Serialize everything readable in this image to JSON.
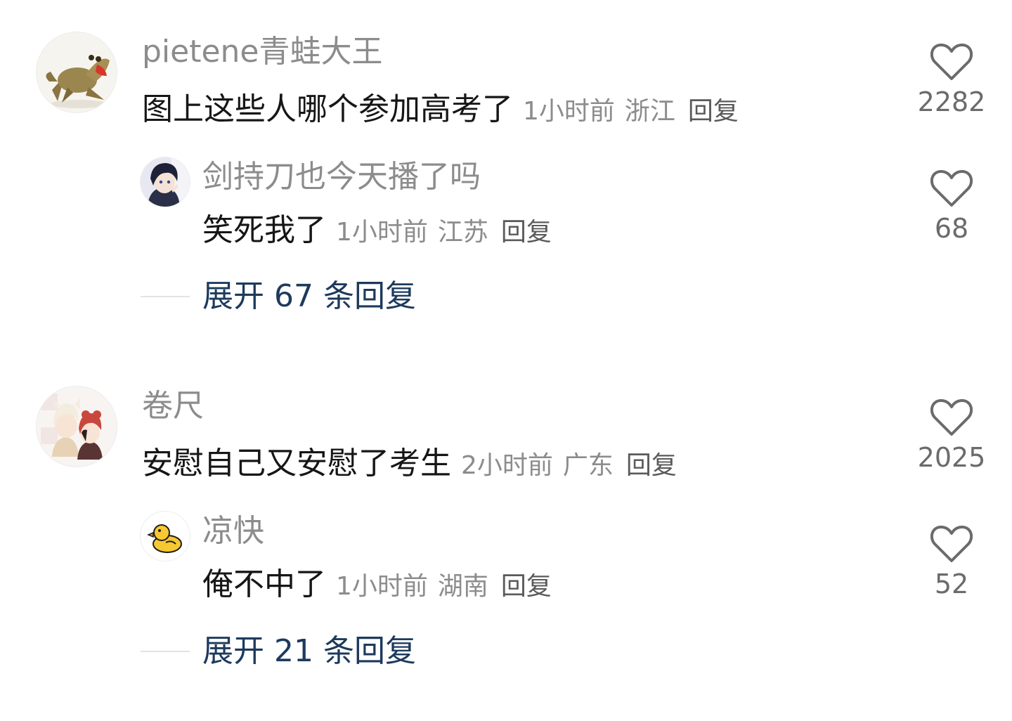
{
  "threads": [
    {
      "comment": {
        "username": "pietene青蛙大王",
        "avatar_icon": "frog-avatar",
        "text": "图上这些人哪个参加高考了",
        "time": "1小时前",
        "location": "浙江",
        "reply_label": "回复",
        "likes": "2282"
      },
      "reply": {
        "username": "剑持刀也今天播了吗",
        "avatar_icon": "anime-boy-avatar",
        "text": "笑死我了",
        "time": "1小时前",
        "location": "江苏",
        "reply_label": "回复",
        "likes": "68"
      },
      "expand_label": "展开 67 条回复"
    },
    {
      "comment": {
        "username": "卷尺",
        "avatar_icon": "anime-couple-avatar",
        "text": "安慰自己又安慰了考生",
        "time": "2小时前",
        "location": "广东",
        "reply_label": "回复",
        "likes": "2025"
      },
      "reply": {
        "username": "凉快",
        "avatar_icon": "rubber-duck-avatar",
        "text": "俺不中了",
        "time": "1小时前",
        "location": "湖南",
        "reply_label": "回复",
        "likes": "52"
      },
      "expand_label": "展开 21 条回复"
    }
  ],
  "colors": {
    "username": "#8c8c8c",
    "comment_text": "#161616",
    "meta": "#8c8c8c",
    "expand_link": "#1d3a5c",
    "heart_outline": "#6b6b6b"
  }
}
